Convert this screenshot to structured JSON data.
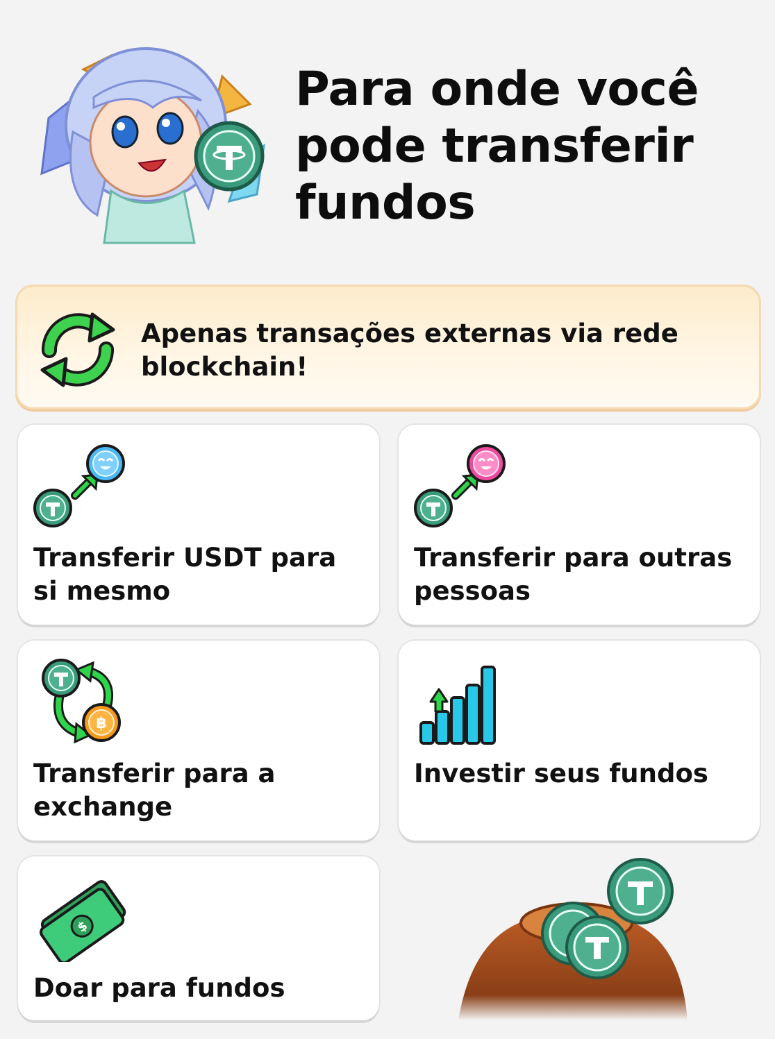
{
  "header": {
    "title": "Para onde você\npode transferir\nfundos"
  },
  "banner": {
    "text": "Apenas transações externas via rede blockchain!",
    "icon": "refresh-arrows-icon"
  },
  "options": [
    {
      "label": "Transferir USDT para si mesmo",
      "icon": "usdt-to-self-icon"
    },
    {
      "label": "Transferir para outras pessoas",
      "icon": "usdt-to-others-icon"
    },
    {
      "label": "Transferir para a exchange",
      "icon": "usdt-bitcoin-exchange-icon"
    },
    {
      "label": "Investir seus fundos",
      "icon": "growth-bars-icon"
    },
    {
      "label": "Doar para fundos",
      "icon": "cash-money-icon"
    }
  ],
  "colors": {
    "background": "#f3f3f3",
    "banner": "#fdeccc",
    "usdt_green": "#2e8b6f",
    "arrow_green": "#22c23a",
    "bitcoin_orange": "#f59a1b",
    "bars_cyan": "#28c8e8"
  }
}
